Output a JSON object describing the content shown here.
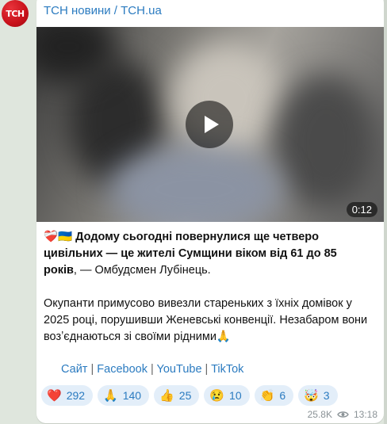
{
  "avatar": {
    "text": "ТСН"
  },
  "channel": {
    "name": "ТСН новини / TCH.ua"
  },
  "video": {
    "duration": "0:12"
  },
  "post": {
    "prefix_emoji": "❤️‍🩹🇺🇦",
    "bold_text": "Додому сьогодні повернулися ще четверо цивільних — це жителі Сумщини віком від 61 до 85 років",
    "rest_text": ", — Омбудсмен Лубінець.",
    "paragraph2": "Окупанти примусово вивезли стареньких з їхніх домівок у 2025 році, порушивши Женевські конвенції. Незабаром вони возʼєднаються зі своїми рідними🙏"
  },
  "links": [
    "Сайт",
    "Facebook",
    "YouTube",
    "TikTok"
  ],
  "reactions": [
    {
      "emoji": "❤️",
      "count": "292"
    },
    {
      "emoji": "🙏",
      "count": "140"
    },
    {
      "emoji": "👍",
      "count": "25"
    },
    {
      "emoji": "😢",
      "count": "10"
    },
    {
      "emoji": "👏",
      "count": "6"
    },
    {
      "emoji": "🤯",
      "count": "3"
    }
  ],
  "meta": {
    "views": "25.8K",
    "time": "13:18"
  },
  "colors": {
    "accent": "#2b7bc0",
    "brand": "#c8111a",
    "background": "#dfe6dd"
  }
}
